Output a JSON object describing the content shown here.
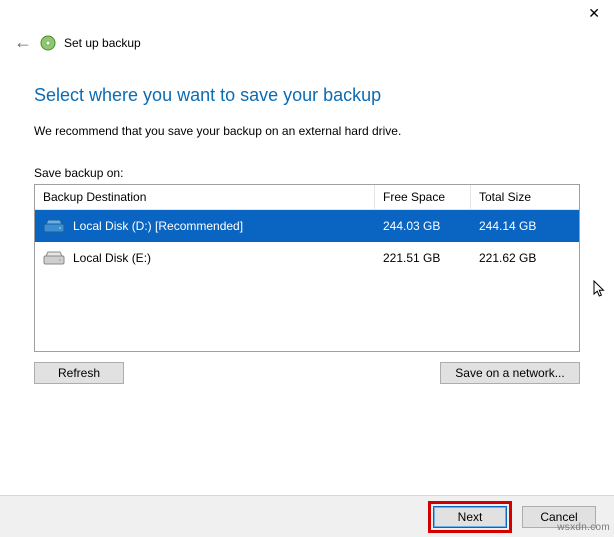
{
  "window": {
    "title": "Set up backup"
  },
  "page": {
    "heading": "Select where you want to save your backup",
    "description": "We recommend that you save your backup on an external hard drive.",
    "list_label": "Save backup on:"
  },
  "table": {
    "headers": {
      "destination": "Backup Destination",
      "free": "Free Space",
      "total": "Total Size"
    },
    "rows": [
      {
        "label": "Local Disk (D:) [Recommended]",
        "free": "244.03 GB",
        "total": "244.14 GB",
        "selected": true
      },
      {
        "label": "Local Disk (E:)",
        "free": "221.51 GB",
        "total": "221.62 GB",
        "selected": false
      }
    ]
  },
  "buttons": {
    "refresh": "Refresh",
    "network": "Save on a network...",
    "next": "Next",
    "cancel": "Cancel"
  },
  "watermark": "wsxdn.com"
}
